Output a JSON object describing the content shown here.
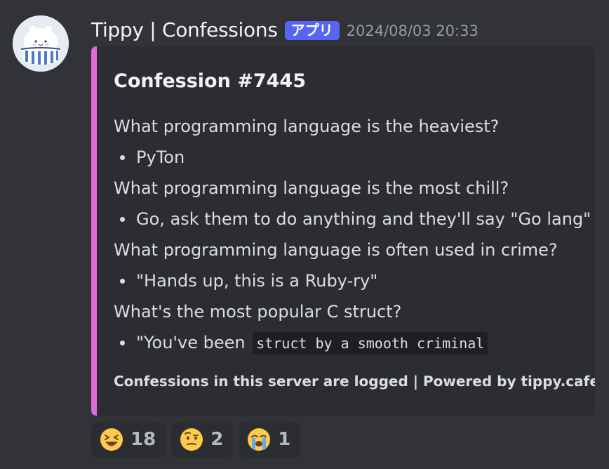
{
  "message": {
    "username": "Tippy | Confessions",
    "app_badge": "アプリ",
    "timestamp": "2024/08/03 20:33",
    "avatar_icon": "cat-in-bowl-avatar"
  },
  "embed": {
    "accent_color": "#e06cd8",
    "title": "Confession #7445",
    "lines": [
      {
        "type": "text",
        "text": "What programming language is the heaviest?"
      },
      {
        "type": "bullet",
        "text": "PyTon"
      },
      {
        "type": "text",
        "text": "What programming language is the most chill?"
      },
      {
        "type": "bullet",
        "text": "Go, ask them to do anything and they'll say \"Go lang\""
      },
      {
        "type": "text",
        "text": "What programming language is often used in crime?"
      },
      {
        "type": "bullet",
        "text": "\"Hands up, this is a Ruby-ry\""
      },
      {
        "type": "text",
        "text": "What's the most popular C struct?"
      },
      {
        "type": "bullet",
        "text": "\"You've been",
        "code": "struct by a smooth criminal"
      }
    ],
    "footer": "Confessions in this server are logged | Powered by tippy.cafe"
  },
  "reactions": [
    {
      "emoji": "laughing-squinting-face-emoji",
      "count": "18"
    },
    {
      "emoji": "face-with-raised-eyebrow-emoji",
      "count": "2"
    },
    {
      "emoji": "loudly-crying-face-emoji",
      "count": "1"
    }
  ]
}
